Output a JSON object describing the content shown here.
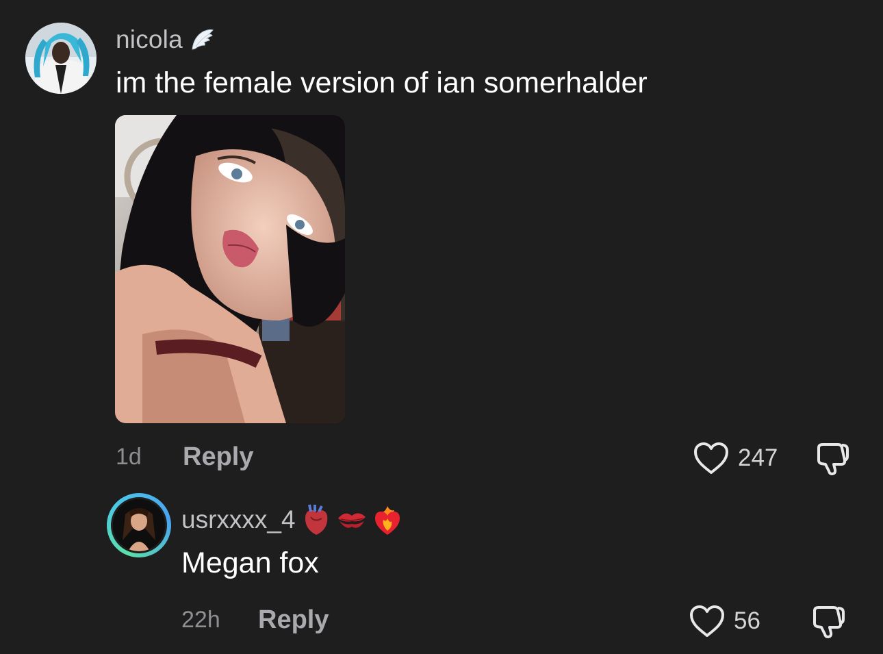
{
  "comments": [
    {
      "username": "nicola",
      "badge_icon": "angel-wing-icon",
      "text": "im the female version of ian somerhalder",
      "has_photo": true,
      "time": "1d",
      "reply_label": "Reply",
      "likes": "247"
    },
    {
      "username": "usrxxxx_4",
      "badge_icons": [
        "anatomical-heart-icon",
        "kiss-mark-icon",
        "heart-on-fire-icon"
      ],
      "text": "Megan fox",
      "time": "22h",
      "reply_label": "Reply",
      "likes": "56"
    }
  ],
  "colors": {
    "background": "#1e1e1f",
    "username": "#c3c3c6",
    "text": "#ffffff",
    "meta": "#8e8e93",
    "story_ring": "#5be0a8"
  }
}
